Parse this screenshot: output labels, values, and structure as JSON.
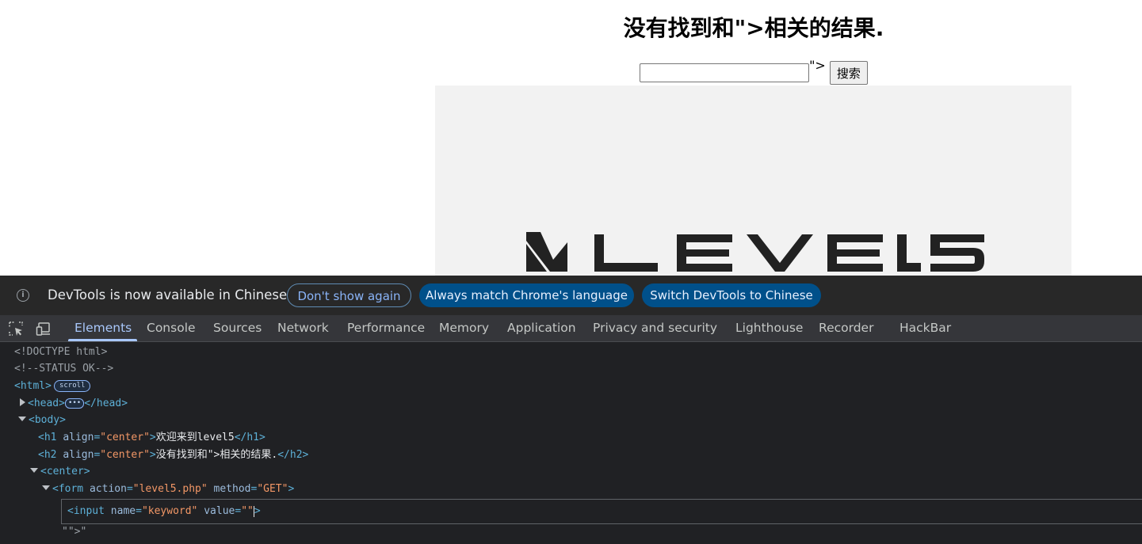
{
  "page": {
    "heading": "没有找到和\">相关的结果.",
    "after_input_text": "\">",
    "search_button_label": "搜索",
    "keyword_value": ""
  },
  "devtools": {
    "infobar": {
      "message": "DevTools is now available in Chinese",
      "dont_show_label": "Don't show again",
      "match_language_label": "Always match Chrome's language",
      "switch_label": "Switch DevTools to Chinese"
    },
    "tabs": [
      "Elements",
      "Console",
      "Sources",
      "Network",
      "Performance",
      "Memory",
      "Application",
      "Privacy and security",
      "Lighthouse",
      "Recorder",
      "HackBar"
    ],
    "active_tab": "Elements",
    "tree": {
      "doctype": "<!DOCTYPE html>",
      "comment": "<!--STATUS OK-->",
      "html_open": "<html>",
      "scroll_badge": "scroll",
      "head_open": "<head>",
      "head_ellipsis": "•••",
      "head_close": "</head>",
      "body_open": "<body>",
      "h1_open_tag": "<h1",
      "h1_attr": "align",
      "h1_val": "\"center\"",
      "h1_text": "欢迎来到level5",
      "h1_close": "</h1>",
      "h2_open_tag": "<h2",
      "h2_attr": "align",
      "h2_val": "\"center\"",
      "h2_text": "没有找到和\">相关的结果.",
      "h2_close": "</h2>",
      "center_open": "<center>",
      "form_tag": "<form",
      "form_action_attr": "action",
      "form_action_val": "\"level5.php\"",
      "form_method_attr": "method",
      "form_method_val": "\"GET\"",
      "input_tag": "<input",
      "input_name_attr": "name",
      "input_name_val": "\"keyword\"",
      "input_value_attr": "value",
      "input_value_val": "\"\"",
      "text_node": "\"\">\""
    }
  },
  "logo_text": "LEVEL5",
  "colors": {
    "devtools_bg": "#202124",
    "accent_blue": "#a8c7fa",
    "button_blue": "#00508a"
  }
}
